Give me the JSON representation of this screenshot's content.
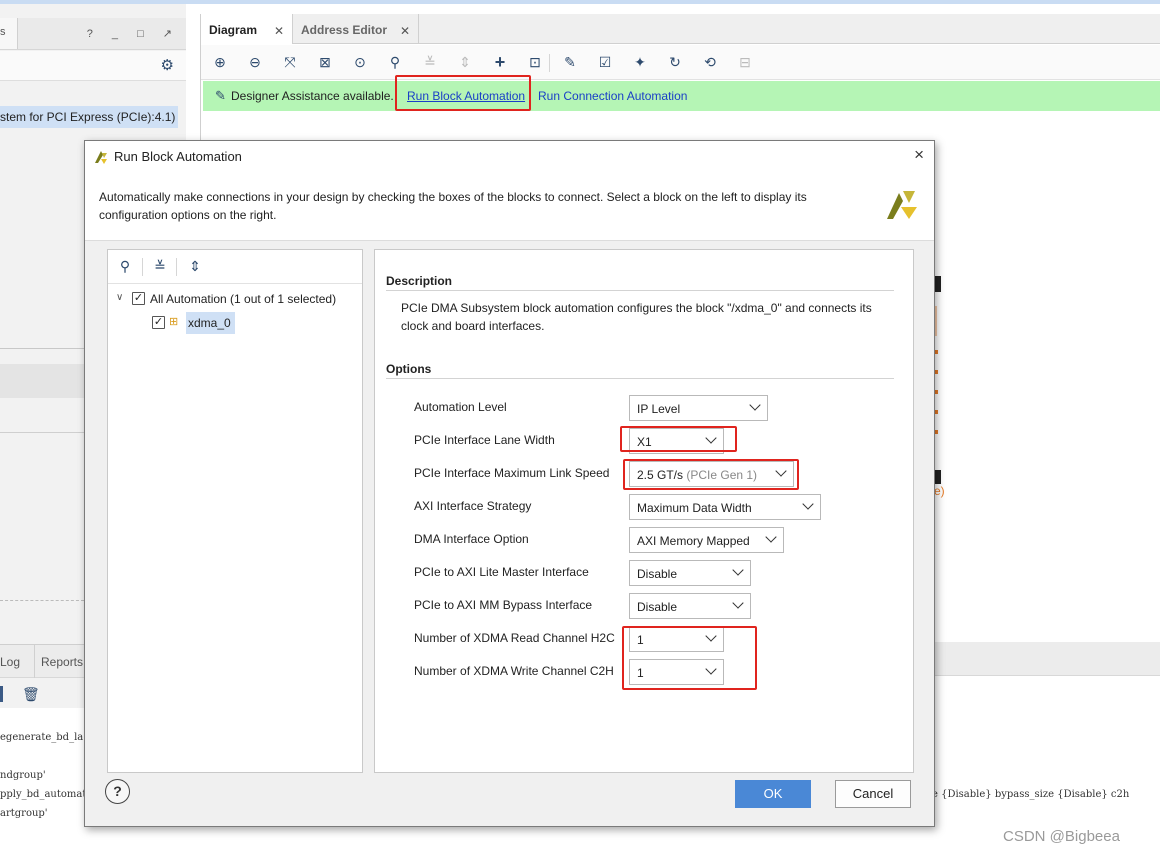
{
  "left_panel": {
    "tab_fragment": "s",
    "window_controls": "? _ □ ↗",
    "selected_item": "stem for PCI Express (PCIe):4.1)",
    "bottom_tabs": [
      "Log",
      "Reports"
    ]
  },
  "main": {
    "tabs": [
      {
        "label": "Diagram"
      },
      {
        "label": "Address Editor"
      }
    ],
    "assistance": {
      "message": "Designer Assistance available.",
      "link_block": "Run Block Automation",
      "link_connection": "Run Connection Automation"
    },
    "bg_orange_fragment": "e)"
  },
  "console": {
    "line1": "egenerate_bd_la",
    "line2": "ndgroup'",
    "line3": "pply_bd_automat",
    "line3_right": "e {Disable} bypass_size {Disable} c2h",
    "line4": "artgroup'"
  },
  "dialog": {
    "title": "Run Block Automation",
    "close": "×",
    "description": "Automatically make connections in your design by checking the boxes of the blocks to connect. Select a block on the left to display its configuration options on the right.",
    "tree": {
      "root_label": "All Automation (1 out of 1 selected)",
      "root_checked": true,
      "child_label": "xdma_0",
      "child_checked": true
    },
    "description_section": {
      "title": "Description",
      "body": "PCIe DMA Subsystem block automation configures the block \"/xdma_0\" and connects its clock and board interfaces."
    },
    "options_section": {
      "title": "Options",
      "rows": [
        {
          "label": "Automation Level",
          "value": "IP Level",
          "hint": ""
        },
        {
          "label": "PCIe Interface Lane Width",
          "value": "X1",
          "hint": ""
        },
        {
          "label": "PCIe Interface Maximum Link Speed",
          "value": "2.5 GT/s",
          "hint": "(PCIe Gen 1)"
        },
        {
          "label": "AXI Interface Strategy",
          "value": "Maximum Data Width",
          "hint": ""
        },
        {
          "label": "DMA Interface Option",
          "value": "AXI Memory Mapped",
          "hint": ""
        },
        {
          "label": "PCIe to AXI Lite Master Interface",
          "value": "Disable",
          "hint": ""
        },
        {
          "label": "PCIe to AXI MM Bypass Interface",
          "value": "Disable",
          "hint": ""
        },
        {
          "label": "Number of XDMA Read Channel H2C",
          "value": "1",
          "hint": ""
        },
        {
          "label": "Number of XDMA Write Channel C2H",
          "value": "1",
          "hint": ""
        }
      ]
    },
    "buttons": {
      "help": "?",
      "ok": "OK",
      "cancel": "Cancel"
    }
  },
  "watermark": "CSDN @Bigbeea",
  "colors": {
    "assist_bar": "#b5f5b5",
    "highlight_red": "#e0241e",
    "ok_blue": "#4a88d6",
    "selection_blue": "#cfe0f5",
    "link_blue": "#1a3fc7"
  },
  "icons": {
    "toolbar": [
      "zoom-in-icon",
      "zoom-out-icon",
      "fit-icon",
      "fit-selection-icon",
      "target-icon",
      "search-icon",
      "collapse-icon",
      "expand-icon",
      "add-icon",
      "add-module-icon",
      "wrench-icon",
      "validate-icon",
      "pin-icon",
      "refresh-icon",
      "regenerate-icon",
      "ip-icon"
    ]
  }
}
